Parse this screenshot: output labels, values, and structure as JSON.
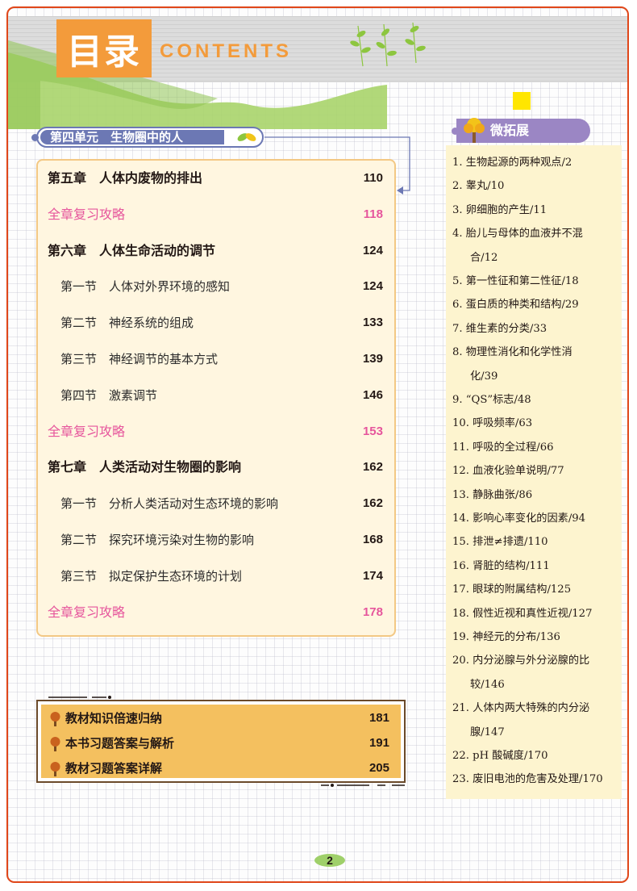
{
  "header": {
    "title_cn": "目录",
    "title_en": "CONTENTS"
  },
  "unit": {
    "title": "第四单元　生物圈中的人"
  },
  "toc": [
    {
      "type": "chapter",
      "text": "第五章　人体内废物的排出",
      "page": "110"
    },
    {
      "type": "review",
      "text": "全章复习攻略",
      "page": "118"
    },
    {
      "type": "chapter",
      "text": "第六章　人体生命活动的调节",
      "page": "124"
    },
    {
      "type": "section",
      "text": "第一节　人体对外界环境的感知",
      "page": "124"
    },
    {
      "type": "section",
      "text": "第二节　神经系统的组成",
      "page": "133"
    },
    {
      "type": "section",
      "text": "第三节　神经调节的基本方式",
      "page": "139"
    },
    {
      "type": "section",
      "text": "第四节　激素调节",
      "page": "146"
    },
    {
      "type": "review",
      "text": "全章复习攻略",
      "page": "153"
    },
    {
      "type": "chapter",
      "text": "第七章　人类活动对生物圈的影响",
      "page": "162"
    },
    {
      "type": "section",
      "text": "第一节　分析人类活动对生态环境的影响",
      "page": "162"
    },
    {
      "type": "section",
      "text": "第二节　探究环境污染对生物的影响",
      "page": "168"
    },
    {
      "type": "section",
      "text": "第三节　拟定保护生态环境的计划",
      "page": "174"
    },
    {
      "type": "review",
      "text": "全章复习攻略",
      "page": "178"
    }
  ],
  "appendix": [
    {
      "text": "教材知识倍速归纳",
      "page": "181"
    },
    {
      "text": "本书习题答案与解析",
      "page": "191"
    },
    {
      "text": "教材习题答案详解",
      "page": "205"
    }
  ],
  "sidebar": {
    "title": "微拓展",
    "items": [
      [
        "1. 生物起源的两种观点/2"
      ],
      [
        "2. 睾丸/10"
      ],
      [
        "3. 卵细胞的产生/11"
      ],
      [
        "4. 胎儿与母体的血液并不混",
        "合/12"
      ],
      [
        "5. 第一性征和第二性征/18"
      ],
      [
        "6. 蛋白质的种类和结构/29"
      ],
      [
        "7. 维生素的分类/33"
      ],
      [
        "8. 物理性消化和化学性消",
        "化/39"
      ],
      [
        "9. “QS”标志/48"
      ],
      [
        "10. 呼吸频率/63"
      ],
      [
        "11. 呼吸的全过程/66"
      ],
      [
        "12. 血液化验单说明/77"
      ],
      [
        "13. 静脉曲张/86"
      ],
      [
        "14. 影响心率变化的因素/94"
      ],
      [
        "15. 排泄≠排遗/110"
      ],
      [
        "16. 肾脏的结构/111"
      ],
      [
        "17. 眼球的附属结构/125"
      ],
      [
        "18. 假性近视和真性近视/127"
      ],
      [
        "19. 神经元的分布/136"
      ],
      [
        "20. 内分泌腺与外分泌腺的比",
        "较/146"
      ],
      [
        "21. 人体内两大特殊的内分泌",
        "腺/147"
      ],
      [
        "22. pH 酸碱度/170"
      ],
      [
        "23. 废旧电池的危害及处理/170"
      ]
    ]
  },
  "page_number": "2"
}
